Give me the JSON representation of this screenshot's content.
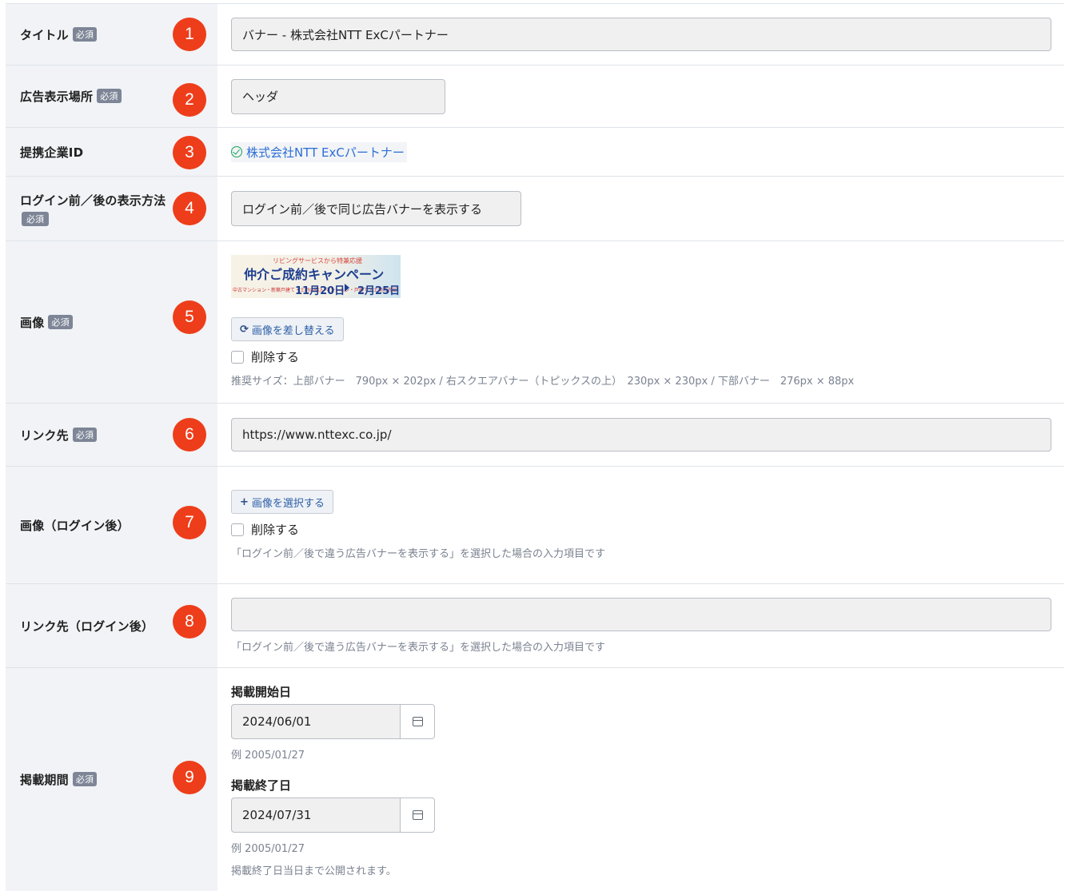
{
  "required_label": "必須",
  "rows": {
    "title": {
      "label": "タイトル",
      "num": "1",
      "value": "バナー - 株式会社NTT ExCパートナー"
    },
    "placement": {
      "label": "広告表示場所",
      "num": "2",
      "value": "ヘッダ"
    },
    "partner": {
      "label": "提携企業ID",
      "num": "3",
      "value": "株式会社NTT ExCパートナー"
    },
    "display_method": {
      "label": "ログイン前／後の表示方法",
      "num": "4",
      "value": "ログイン前／後で同じ広告バナーを表示する"
    },
    "image": {
      "label": "画像",
      "num": "5",
      "banner": {
        "line1": "リビングサービスから特兼応援",
        "line2": "仲介ご成約キャンペーン",
        "line3": "中古マンション・新築戸建て・土地の購入 マンション・戸建て・土地の売却",
        "date_start": "11月20日",
        "date_end": "2月25日"
      },
      "replace_button": "画像を差し替える",
      "delete_label": "削除する",
      "help": "推奨サイズ：上部バナー　790px × 202px / 右スクエアバナー（トピックスの上）　230px × 230px / 下部バナー　276px × 88px"
    },
    "link": {
      "label": "リンク先",
      "num": "6",
      "value": "https://www.nttexc.co.jp/"
    },
    "image_after": {
      "label": "画像（ログイン後）",
      "num": "7",
      "select_button": "画像を選択する",
      "delete_label": "削除する",
      "help": "「ログイン前／後で違う広告バナーを表示する」を選択した場合の入力項目です"
    },
    "link_after": {
      "label": "リンク先（ログイン後）",
      "num": "8",
      "value": "",
      "help": "「ログイン前／後で違う広告バナーを表示する」を選択した場合の入力項目です"
    },
    "period": {
      "label": "掲載期間",
      "num": "9",
      "start_label": "掲載開始日",
      "start_value": "2024/06/01",
      "start_example": "例 2005/01/27",
      "end_label": "掲載終了日",
      "end_value": "2024/07/31",
      "end_example": "例 2005/01/27",
      "note": "掲載終了日当日まで公開されます。"
    }
  },
  "colors": {
    "accent_red": "#ee3d1a",
    "link_blue": "#2c6ed5",
    "label_bg": "#f1f3f6"
  },
  "icons": {
    "check": "check-circle-icon",
    "refresh": "refresh-icon",
    "plus": "plus-icon",
    "calendar": "calendar-icon"
  }
}
